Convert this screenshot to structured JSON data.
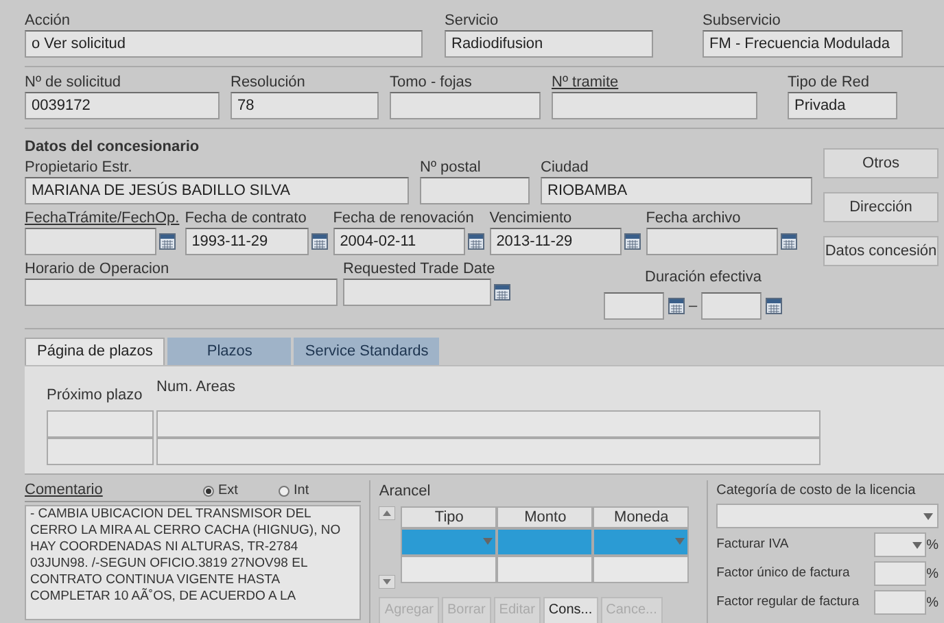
{
  "top_fields": [
    {
      "label": "Acción",
      "value": "o Ver solicitud"
    },
    {
      "label": "Servicio",
      "value": "Radiodifusion"
    },
    {
      "label": "Subservicio",
      "value": "FM - Frecuencia Modulada"
    }
  ],
  "request_fields": [
    {
      "label": "Nº de solicitud",
      "value": "0039172",
      "link": false
    },
    {
      "label": "Resolución",
      "value": "78",
      "link": false
    },
    {
      "label": "Tomo - fojas",
      "link": false
    },
    {
      "label": "Nº tramite",
      "link": true
    },
    {
      "label": "Tipo de Red",
      "value": "Privada",
      "link": false
    }
  ],
  "concesionario": {
    "title": "Datos del concesionario",
    "fields": [
      {
        "label": "Propietario Estr.",
        "value": "MARIANA DE JESÚS BADILLO SILVA"
      },
      {
        "label": "Nº postal"
      },
      {
        "label": "Ciudad",
        "value": "RIOBAMBA"
      }
    ],
    "dates": [
      {
        "label": "FechaTrámite/FechOp.",
        "link": true
      },
      {
        "label": "Fecha de contrato",
        "value": "1993-11-29",
        "link": false
      },
      {
        "label": "Fecha de renovación",
        "value": "2004-02-11",
        "link": false
      },
      {
        "label": "Vencimiento",
        "value": "2013-11-29",
        "link": false
      },
      {
        "label": "Fecha archivo",
        "link": false
      }
    ],
    "horario": {
      "label": "Horario de Operacion"
    },
    "trade_date": {
      "label": "Requested Trade Date"
    },
    "duracion": {
      "label": "Duración efectiva",
      "separator": "–"
    },
    "buttons": [
      "Otros",
      "Dirección",
      "Datos concesión"
    ]
  },
  "tabs": [
    {
      "label": "Página de plazos",
      "selected": true
    },
    {
      "label": "Plazos",
      "selected": false
    },
    {
      "label": "Service Standards",
      "selected": false
    }
  ],
  "plazos_table": {
    "columns": [
      "Próximo plazo",
      "Num. Areas"
    ]
  },
  "comentario": {
    "label": "Comentario",
    "options": [
      {
        "label": "Ext",
        "selected": true
      },
      {
        "label": "Int",
        "selected": false
      }
    ],
    "text": "- CAMBIA UBICACION DEL TRANSMISOR DEL CERRO LA MIRA AL CERRO CACHA (HIGNUG), NO HAY COORDENADAS NI ALTURAS, TR-2784 03JUN98. /-SEGUN OFICIO.3819 27NOV98 EL CONTRATO CONTINUA VIGENTE HASTA COMPLETAR 10 AÃ˚OS, DE ACUERDO A LA"
  },
  "arancel": {
    "label": "Arancel",
    "columns": [
      "Tipo",
      "Monto",
      "Moneda"
    ],
    "buttons": [
      {
        "label": "Agregar",
        "disabled": true
      },
      {
        "label": "Borrar",
        "disabled": true
      },
      {
        "label": "Editar",
        "disabled": true
      },
      {
        "label": "Cons...",
        "disabled": false
      },
      {
        "label": "Cance...",
        "disabled": true
      }
    ]
  },
  "licencia": {
    "label": "Categoría de costo de la licencia",
    "fields": [
      {
        "label": "Facturar IVA",
        "unit": "%",
        "kind": "dropdown"
      },
      {
        "label": "Factor único de factura",
        "unit": "%",
        "kind": "text"
      },
      {
        "label": "Factor regular de factura",
        "unit": "%",
        "kind": "text"
      }
    ]
  }
}
